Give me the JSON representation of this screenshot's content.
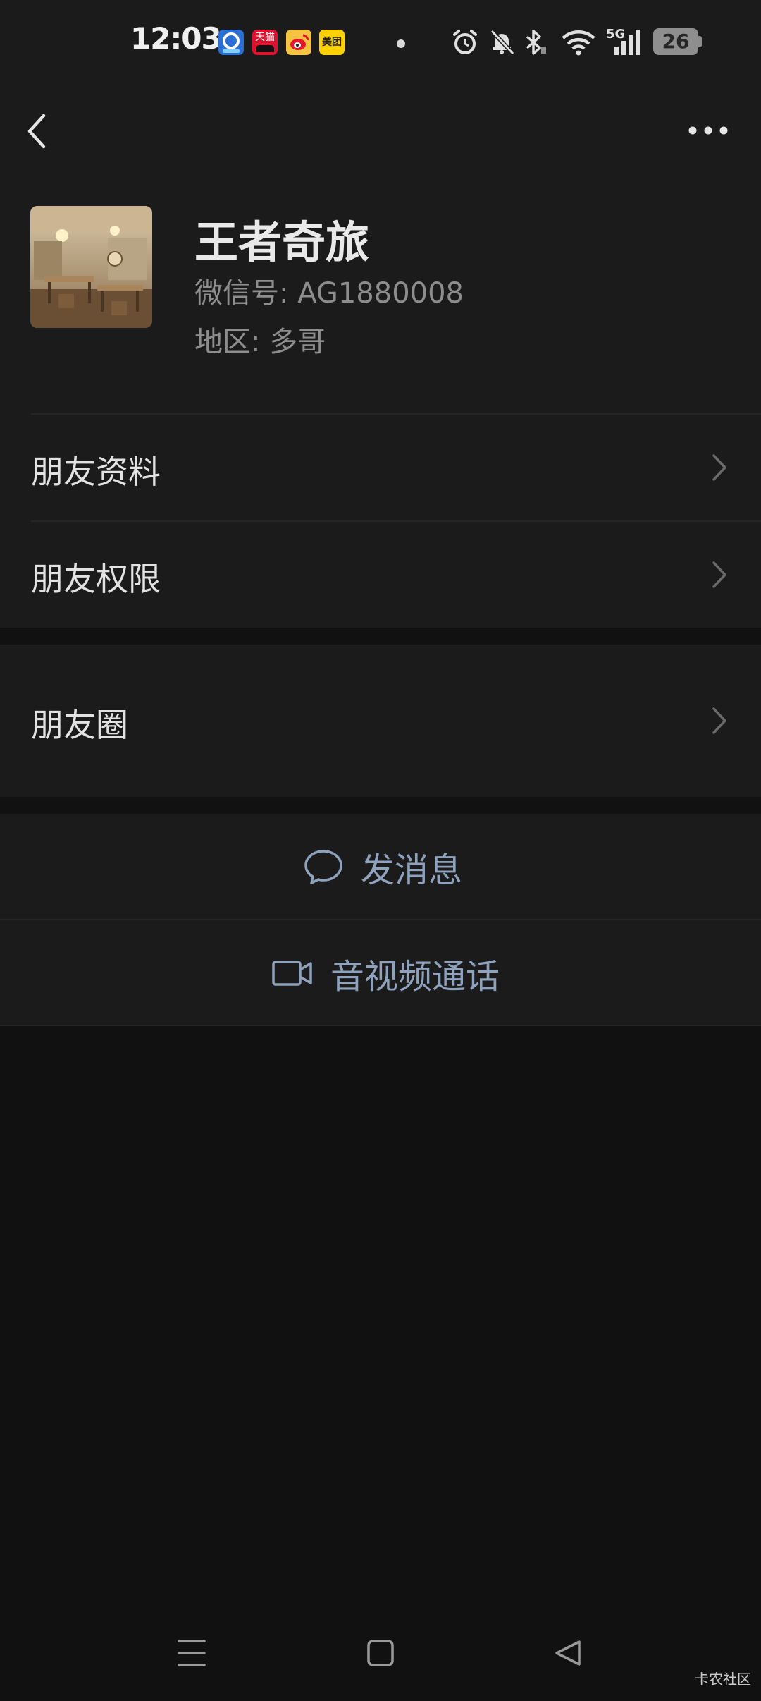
{
  "status_bar": {
    "time": "12:03",
    "notification_apps": [
      "qq-browser-icon",
      "tmall-icon",
      "weibo-icon",
      "meituan-icon"
    ],
    "tmall_label": "天猫",
    "meituan_label": "美团",
    "network": "5G",
    "battery": "26"
  },
  "nav": {
    "back_icon": "chevron-left-icon",
    "more_icon": "more-dots-icon"
  },
  "profile": {
    "nickname": "王者奇旅",
    "wechat_id": "微信号: AG1880008",
    "region": "地区: 多哥"
  },
  "menu": {
    "friend_info": "朋友资料",
    "friend_permissions": "朋友权限",
    "moments": "朋友圈"
  },
  "actions": {
    "send_message": "发消息",
    "av_call": "音视频通话"
  },
  "system_nav": [
    "menu-lines-icon",
    "home-square-icon",
    "back-triangle-icon"
  ],
  "watermark": "卡农社区",
  "colors": {
    "background": "#111111",
    "card": "#1b1b1b",
    "action_text": "#8fa2bd",
    "secondary_text": "#8d8d8d"
  }
}
